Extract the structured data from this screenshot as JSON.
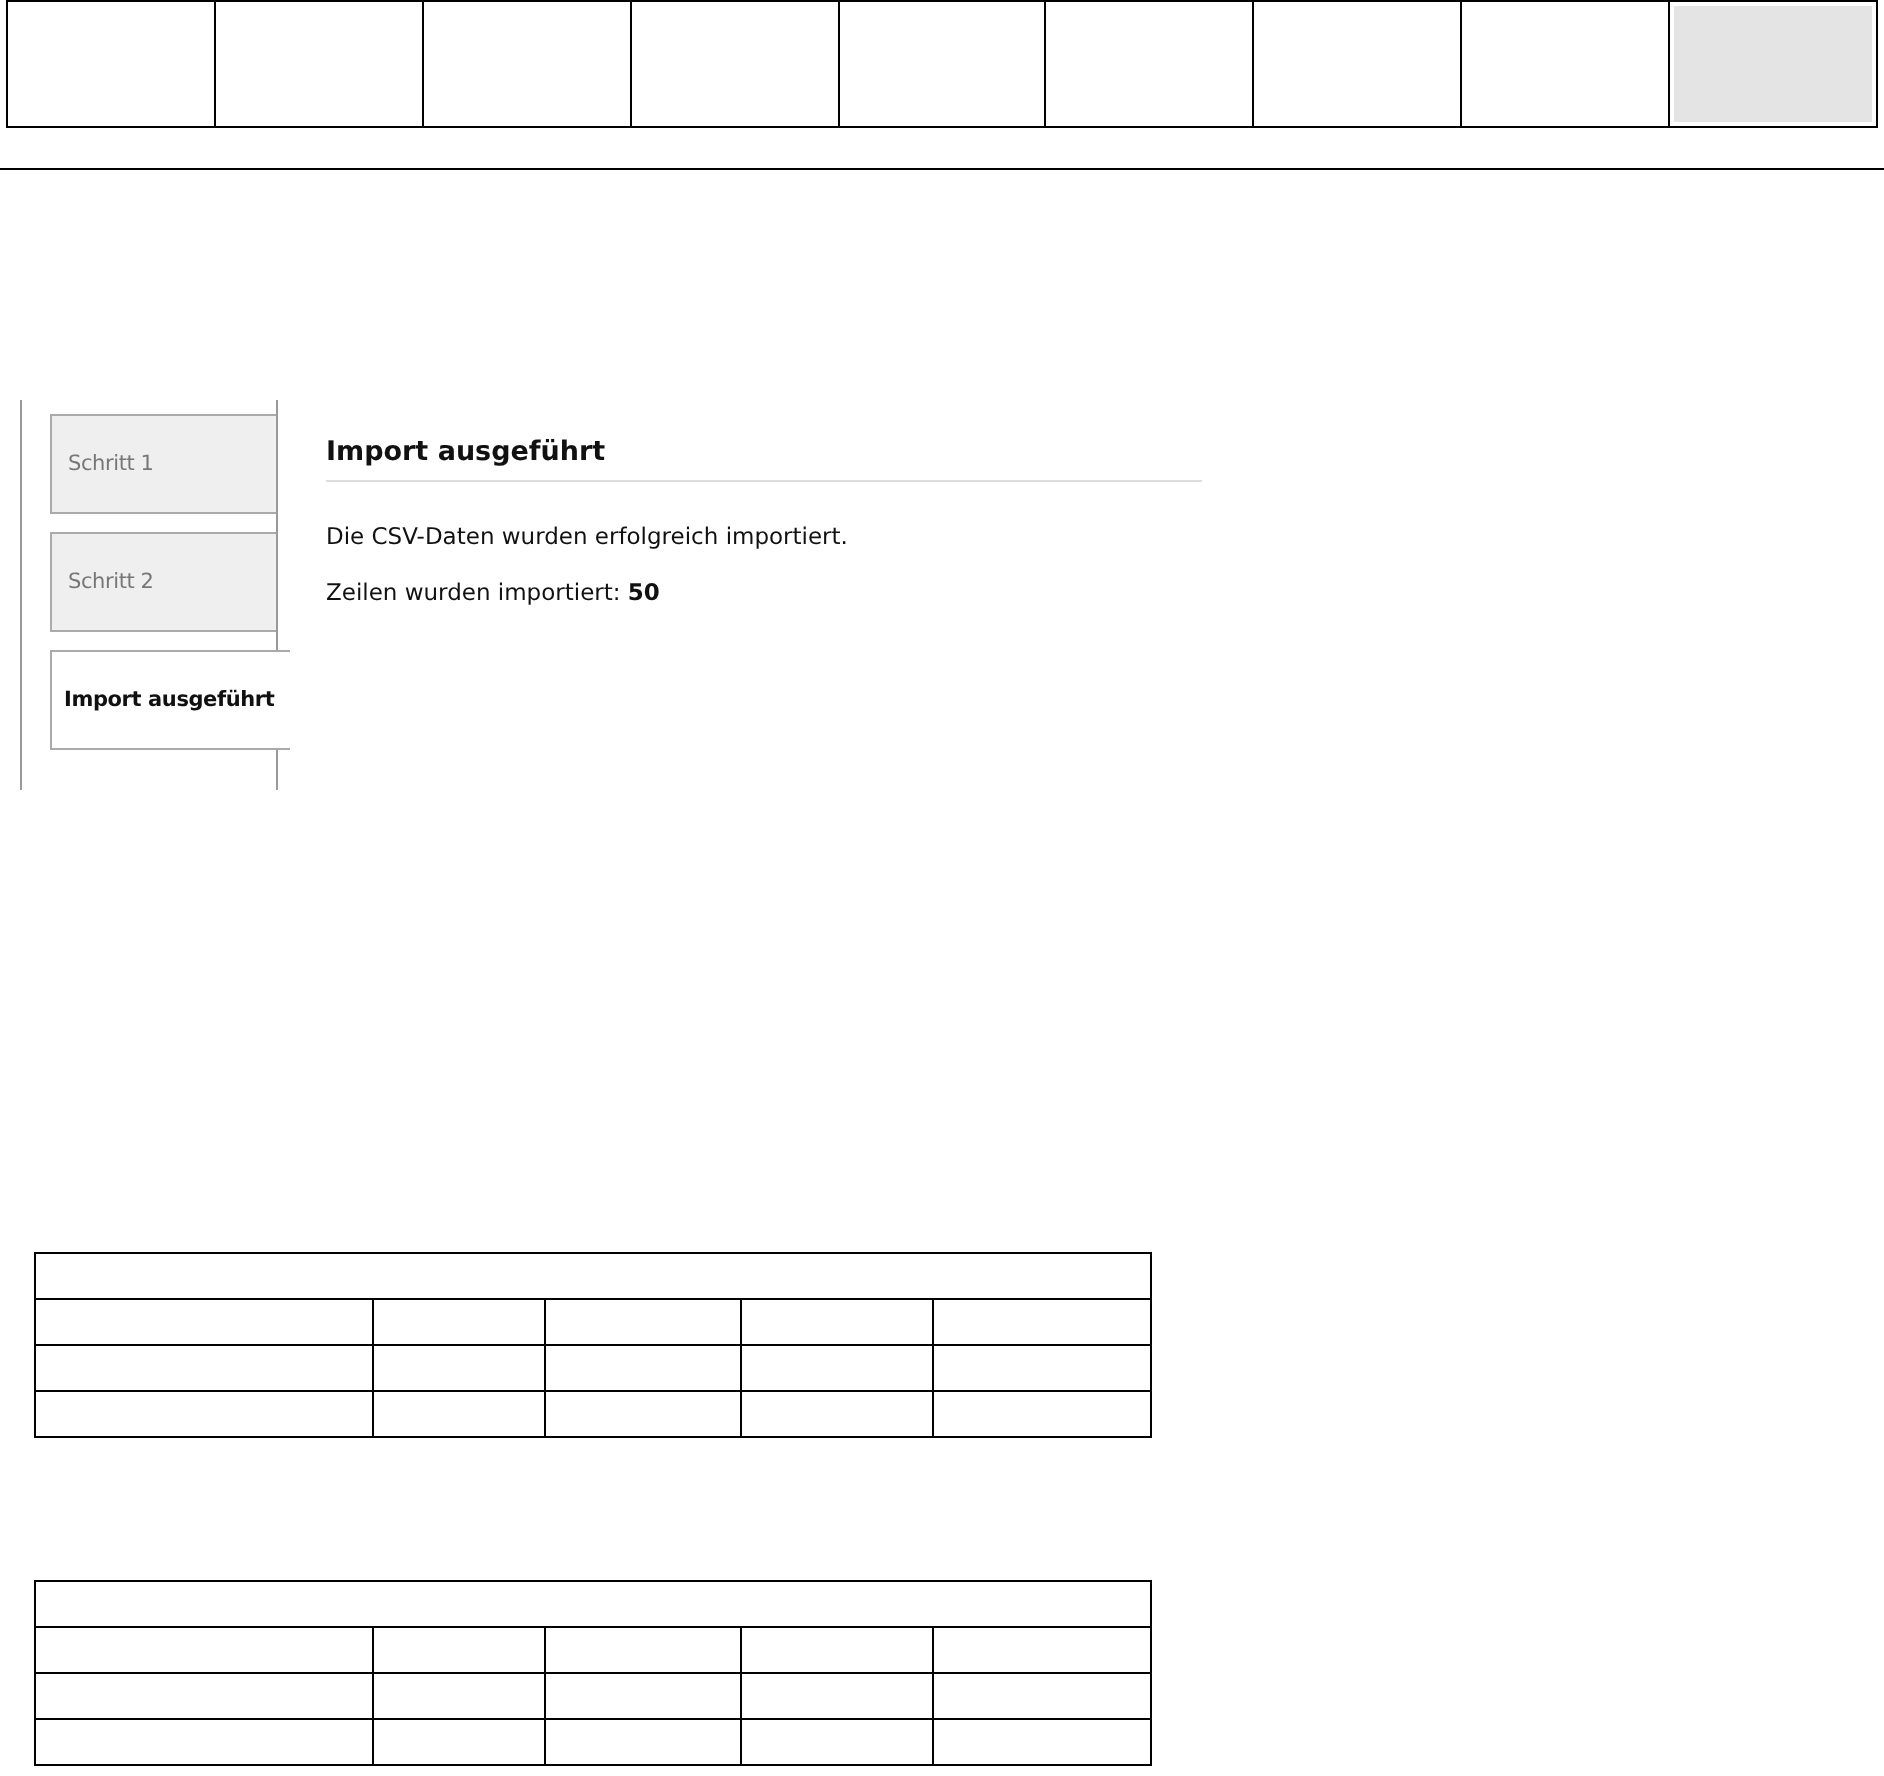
{
  "top_bar": {
    "cells": [
      {
        "selected": false
      },
      {
        "selected": false
      },
      {
        "selected": false
      },
      {
        "selected": false
      },
      {
        "selected": false
      },
      {
        "selected": false
      },
      {
        "selected": false
      },
      {
        "selected": false
      },
      {
        "selected": true
      }
    ]
  },
  "wizard": {
    "steps": [
      {
        "label": "Schritt 1",
        "selected": false
      },
      {
        "label": "Schritt 2",
        "selected": false
      },
      {
        "label": "Import ausgeführt",
        "selected": true
      }
    ],
    "title": "Import ausgeführt",
    "messages": [
      "Die CSV-Daten wurden erfolgreich importiert.",
      "Zeilen wurden importiert: **50**"
    ]
  },
  "tables": [
    {
      "kind": "empty-grid"
    },
    {
      "kind": "empty-grid"
    }
  ]
}
